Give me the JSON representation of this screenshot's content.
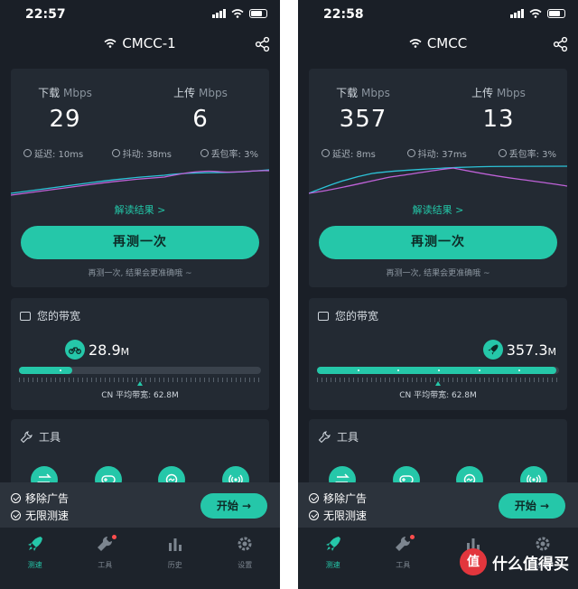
{
  "colors": {
    "accent": "#25c7a9",
    "background": "#1a1f27",
    "card": "#232a33",
    "download_line": "#2cc3d8",
    "upload_line": "#c062d9"
  },
  "left": {
    "time": "22:57",
    "ssid": "CMCC-1",
    "download_label": "下载",
    "upload_label": "上传",
    "unit": "Mbps",
    "download_value": "29",
    "upload_value": "6",
    "latency": "延迟: 10ms",
    "jitter": "抖动: 38ms",
    "loss": "丢包率: 3%",
    "interpret": "解读结果 >",
    "retest_label": "再测一次",
    "hint": "再测一次, 结果会更准确哦 ~",
    "bandwidth_title": "您的带宽",
    "bandwidth_value": "28.9",
    "bandwidth_unit": "M",
    "bandwidth_fraction": 0.22,
    "avg_label": "CN 平均带宽: 62.8M",
    "avg_fraction": 0.5,
    "tools_title": "工具"
  },
  "right": {
    "time": "22:58",
    "ssid": "CMCC",
    "download_label": "下载",
    "upload_label": "上传",
    "unit": "Mbps",
    "download_value": "357",
    "upload_value": "13",
    "latency": "延迟: 8ms",
    "jitter": "抖动: 37ms",
    "loss": "丢包率: 3%",
    "interpret": "解读结果 >",
    "retest_label": "再测一次",
    "hint": "再测一次, 结果会更准确哦 ~",
    "bandwidth_title": "您的带宽",
    "bandwidth_value": "357.3",
    "bandwidth_unit": "M",
    "bandwidth_fraction": 0.99,
    "avg_label": "CN 平均带宽: 62.8M",
    "avg_fraction": 0.5,
    "tools_title": "工具"
  },
  "ad": {
    "item1": "移除广告",
    "item2": "无限测速",
    "start_label": "开始 →"
  },
  "tabs": [
    {
      "label": "测速",
      "icon": "rocket-icon",
      "active": true
    },
    {
      "label": "工具",
      "icon": "wrench-icon",
      "active": false
    },
    {
      "label": "历史",
      "icon": "chart-icon",
      "active": false
    },
    {
      "label": "设置",
      "icon": "gear-icon",
      "active": false
    }
  ],
  "watermark": {
    "logo": "值",
    "text": "什么值得买"
  }
}
